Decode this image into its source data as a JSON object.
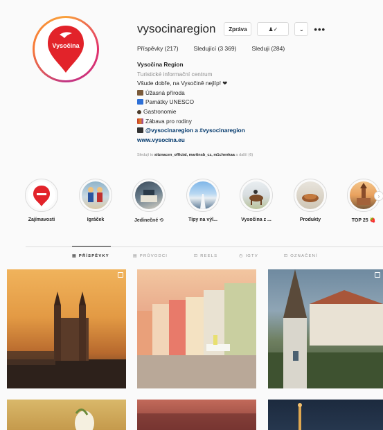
{
  "profile": {
    "username": "vysocinaregion",
    "message_label": "Zpráva",
    "follow_label": "♟✓",
    "more_label": "•••",
    "dropdown_label": "⌄",
    "logo_text": "Vysočina",
    "stats": {
      "posts": "Příspěvky (217)",
      "followers": "Sledující (3 369)",
      "following": "Sleduji (284)"
    },
    "bio": {
      "name": "Vysočina Region",
      "category": "Turistické informační centrum",
      "tagline": "Všude dobře, na Vysočině nejlíp! ❤",
      "line_nature": "Úžasná příroda",
      "line_unesco": "Památky UNESCO",
      "line_gastro": "Gastronomie",
      "line_family": "Zábava pro rodiny",
      "line_hashtags": "@vysocinaregion a #vysocinaregion",
      "website": "www.vysocina.eu"
    },
    "followed_by_prefix": "Sledují to",
    "followed_by_names": "sitznacen_official, martinsb_cz, m1chenkaa",
    "followed_by_more": "a další (6)"
  },
  "highlights": [
    {
      "label": "Zajímavosti"
    },
    {
      "label": "Igráček"
    },
    {
      "label": "Jedinečné ⟲"
    },
    {
      "label": "Tipy na výl..."
    },
    {
      "label": "Vysočina z ..."
    },
    {
      "label": "Produkty"
    },
    {
      "label": "TOP 25 🍓"
    }
  ],
  "tabs": {
    "posts": "PŘÍSPĚVKY",
    "guides": "PRŮVODCI",
    "reels": "REELS",
    "igtv": "IGTV",
    "tagged": "OZNAČENÍ"
  },
  "icons": {
    "posts": "posts-grid-icon",
    "guides": "guides-icon",
    "reels": "reels-icon",
    "igtv": "igtv-icon",
    "tagged": "tagged-icon"
  },
  "colors": {
    "logo_red": "#e2232a",
    "link_blue": "#00376b",
    "muted": "#8e8e8e",
    "border": "#dbdbdb"
  }
}
